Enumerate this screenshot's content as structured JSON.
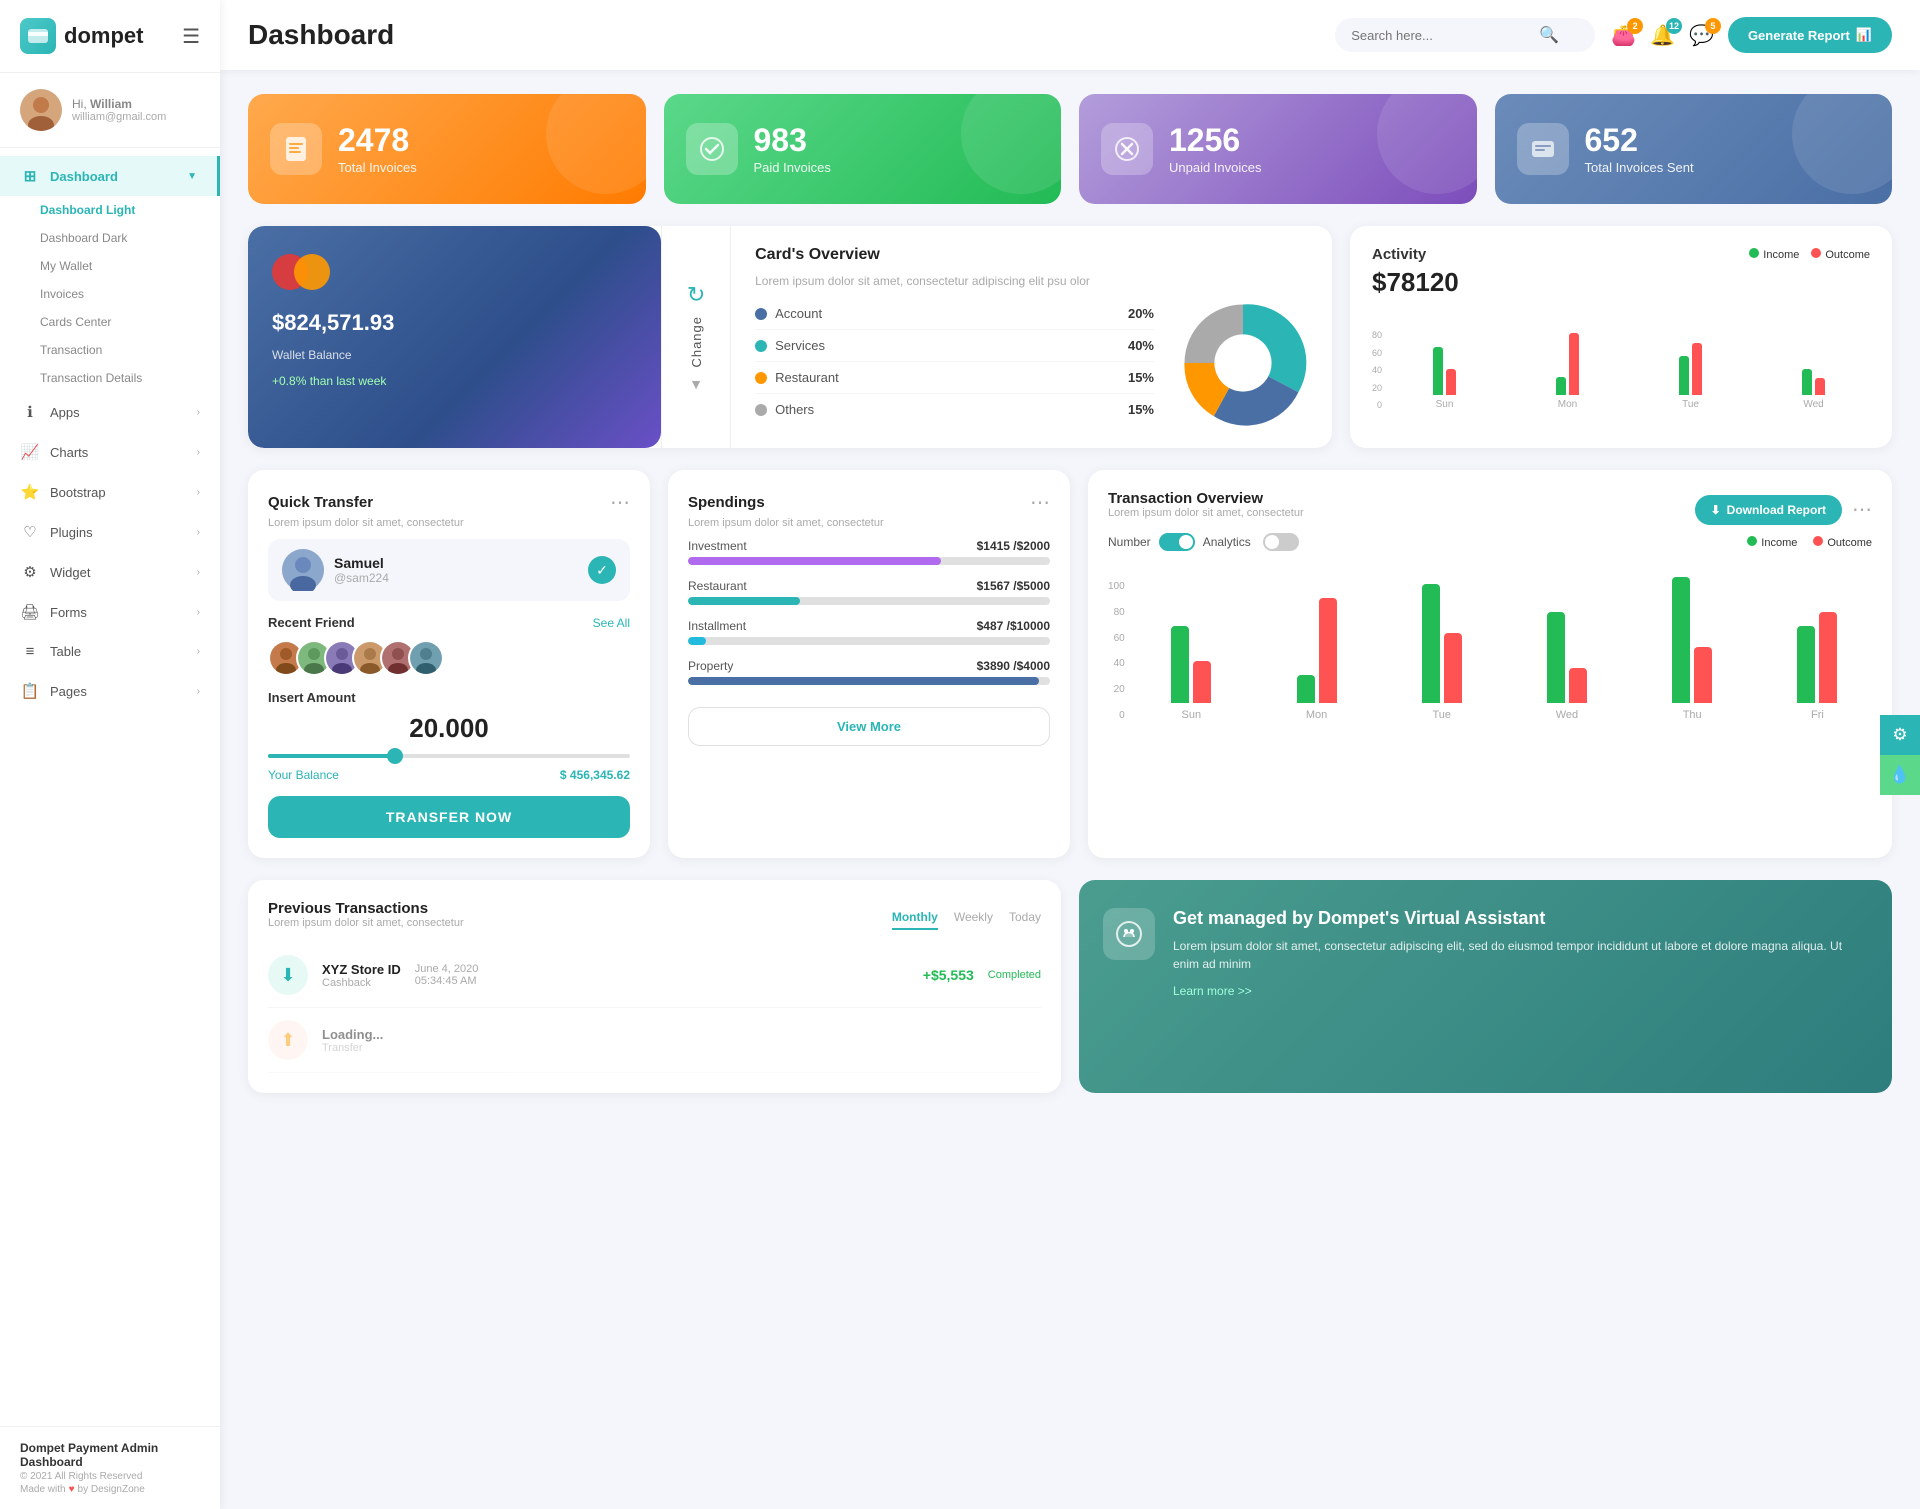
{
  "sidebar": {
    "logo": "dompet",
    "logo_icon": "👛",
    "user": {
      "hi": "Hi,",
      "name": "William",
      "email": "william@gmail.com"
    },
    "nav": [
      {
        "id": "dashboard",
        "icon": "⊞",
        "label": "Dashboard",
        "active": true,
        "hasArrow": true,
        "arrowDown": true
      },
      {
        "id": "apps",
        "icon": "ℹ",
        "label": "Apps",
        "active": false,
        "hasArrow": true
      },
      {
        "id": "charts",
        "icon": "📈",
        "label": "Charts",
        "active": false,
        "hasArrow": true
      },
      {
        "id": "bootstrap",
        "icon": "⭐",
        "label": "Bootstrap",
        "active": false,
        "hasArrow": true
      },
      {
        "id": "plugins",
        "icon": "♡",
        "label": "Plugins",
        "active": false,
        "hasArrow": true
      },
      {
        "id": "widget",
        "icon": "⚙",
        "label": "Widget",
        "active": false,
        "hasArrow": true
      },
      {
        "id": "forms",
        "icon": "🖨",
        "label": "Forms",
        "active": false,
        "hasArrow": true
      },
      {
        "id": "table",
        "icon": "≡",
        "label": "Table",
        "active": false,
        "hasArrow": true
      },
      {
        "id": "pages",
        "icon": "📋",
        "label": "Pages",
        "active": false,
        "hasArrow": true
      }
    ],
    "sub_nav": [
      {
        "id": "dashboard-light",
        "label": "Dashboard Light",
        "active": true
      },
      {
        "id": "dashboard-dark",
        "label": "Dashboard Dark",
        "active": false
      },
      {
        "id": "my-wallet",
        "label": "My Wallet",
        "active": false
      },
      {
        "id": "invoices",
        "label": "Invoices",
        "active": false
      },
      {
        "id": "cards-center",
        "label": "Cards Center",
        "active": false
      },
      {
        "id": "transaction",
        "label": "Transaction",
        "active": false
      },
      {
        "id": "transaction-details",
        "label": "Transaction Details",
        "active": false
      }
    ],
    "footer": {
      "title": "Dompet Payment Admin Dashboard",
      "copy": "© 2021 All Rights Reserved",
      "made": "Made with ♥ by DesignZone"
    }
  },
  "header": {
    "title": "Dashboard",
    "search_placeholder": "Search here...",
    "icons": {
      "wallet_badge": "2",
      "bell_badge": "12",
      "chat_badge": "5"
    },
    "generate_btn": "Generate Report"
  },
  "stat_cards": [
    {
      "id": "total-invoices",
      "number": "2478",
      "label": "Total Invoices",
      "color": "orange",
      "icon": "📋"
    },
    {
      "id": "paid-invoices",
      "number": "983",
      "label": "Paid Invoices",
      "color": "green",
      "icon": "✅"
    },
    {
      "id": "unpaid-invoices",
      "number": "1256",
      "label": "Unpaid Invoices",
      "color": "purple",
      "icon": "⊗"
    },
    {
      "id": "total-sent",
      "number": "652",
      "label": "Total Invoices Sent",
      "color": "blue-gray",
      "icon": "📤"
    }
  ],
  "wallet": {
    "balance": "$824,571.93",
    "label": "Wallet Balance",
    "change": "+0.8% than last week",
    "change_btn": "Change"
  },
  "card_overview": {
    "title": "Card's Overview",
    "desc": "Lorem ipsum dolor sit amet, consectetur adipiscing elit psu olor",
    "items": [
      {
        "label": "Account",
        "pct": "20%",
        "color": "#4a6fa5"
      },
      {
        "label": "Services",
        "pct": "40%",
        "color": "#2bb5b5"
      },
      {
        "label": "Restaurant",
        "pct": "15%",
        "color": "#ff9800"
      },
      {
        "label": "Others",
        "pct": "15%",
        "color": "#aaa"
      }
    ]
  },
  "activity": {
    "title": "Activity",
    "amount": "$78120",
    "income_label": "Income",
    "outcome_label": "Outcome",
    "income_color": "#22bb55",
    "outcome_color": "#ff5252",
    "bars": [
      {
        "day": "Sun",
        "income": 55,
        "outcome": 30
      },
      {
        "day": "Mon",
        "income": 20,
        "outcome": 70
      },
      {
        "day": "Tue",
        "income": 45,
        "outcome": 60
      },
      {
        "day": "Wed",
        "income": 30,
        "outcome": 20
      }
    ],
    "y_axis": [
      "80",
      "60",
      "40",
      "20",
      "0"
    ]
  },
  "quick_transfer": {
    "title": "Quick Transfer",
    "desc": "Lorem ipsum dolor sit amet, consectetur",
    "user": {
      "name": "Samuel",
      "handle": "@sam224"
    },
    "recent_friend_label": "Recent Friend",
    "see_all": "See All",
    "insert_amount_label": "Insert Amount",
    "amount": "20.000",
    "balance_label": "Your Balance",
    "balance_amount": "$ 456,345.62",
    "transfer_btn": "TRANSFER NOW"
  },
  "spendings": {
    "title": "Spendings",
    "desc": "Lorem ipsum dolor sit amet, consectetur",
    "items": [
      {
        "label": "Investment",
        "current": "$1415",
        "total": "$2000",
        "pct": 70,
        "color": "#b06aed"
      },
      {
        "label": "Restaurant",
        "current": "$1567",
        "total": "$5000",
        "pct": 31,
        "color": "#2bb5b5"
      },
      {
        "label": "Installment",
        "current": "$487",
        "total": "$10000",
        "pct": 5,
        "color": "#22bbdd"
      },
      {
        "label": "Property",
        "current": "$3890",
        "total": "$4000",
        "pct": 97,
        "color": "#4a6fa5"
      }
    ],
    "view_more_btn": "View More"
  },
  "transaction_overview": {
    "title": "Transaction Overview",
    "desc": "Lorem ipsum dolor sit amet, consectetur",
    "download_btn": "Download Report",
    "number_label": "Number",
    "analytics_label": "Analytics",
    "income_label": "Income",
    "outcome_label": "Outcome",
    "income_color": "#22bb55",
    "outcome_color": "#ff5252",
    "y_axis": [
      "100",
      "80",
      "60",
      "40",
      "20",
      "0"
    ],
    "bars": [
      {
        "day": "Sun",
        "income": 55,
        "outcome": 30
      },
      {
        "day": "Mon",
        "income": 20,
        "outcome": 75
      },
      {
        "day": "Tue",
        "income": 85,
        "outcome": 50
      },
      {
        "day": "Wed",
        "income": 65,
        "outcome": 25
      },
      {
        "day": "Thu",
        "income": 90,
        "outcome": 40
      },
      {
        "day": "Fri",
        "income": 55,
        "outcome": 65
      }
    ]
  },
  "previous_transactions": {
    "title": "Previous Transactions",
    "desc": "Lorem ipsum dolor sit amet, consectetur",
    "tabs": [
      "Monthly",
      "Weekly",
      "Today"
    ],
    "active_tab": "Monthly",
    "items": [
      {
        "icon": "⬇",
        "name": "XYZ Store ID",
        "sub": "Cashback",
        "date": "June 4, 2020",
        "time": "05:34:45 AM",
        "amount": "+$5,553",
        "status": "Completed"
      }
    ]
  },
  "va_banner": {
    "title": "Get managed by Dompet's Virtual Assistant",
    "desc": "Lorem ipsum dolor sit amet, consectetur adipiscing elit, sed do eiusmod tempor incididunt ut labore et dolore magna aliqua. Ut enim ad minim",
    "learn_more": "Learn more >>",
    "icon": "💰"
  },
  "right_toolbar": {
    "gear_icon": "⚙",
    "drop_icon": "💧"
  }
}
